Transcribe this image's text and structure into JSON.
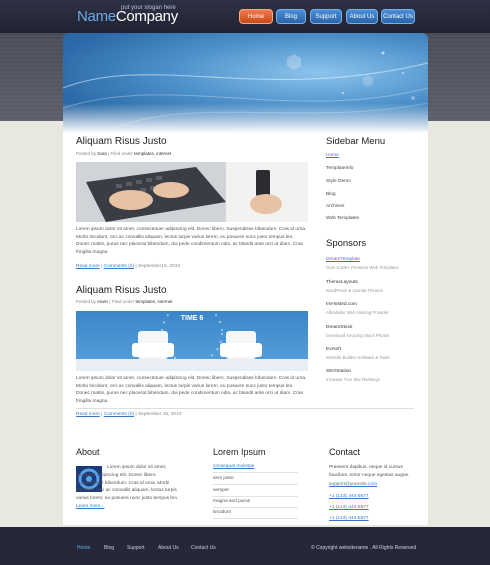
{
  "header": {
    "logo_name": "Name",
    "logo_company": "Company",
    "slogan": "put your slogan here",
    "nav": [
      "Home",
      "Blog",
      "Support",
      "About Us",
      "Contact Us"
    ]
  },
  "posts": [
    {
      "title": "Aliquam Risus Justo",
      "meta_posted": "Posted by",
      "meta_author": "Sara",
      "meta_filed": "| Filed under",
      "meta_tags": "templates, internet",
      "text": "Lorem ipsum dolor sit amet, consectetuer adipiscing elit. Donec libero. Suspendisse bibendum. Cras id urna. Morbi tincidunt, orci ac convallis aliquam, lectus turpis varius lorem, eu posuere nunc justo tempus leo. Donec mattis, purus nec placerat bibendum, dui pede condimentum odio, ac blandit ante orci ut diam. Cras fringilla magna.",
      "read_more": "Read more",
      "comments": "Comments (0)",
      "date": "| September16, 2010"
    },
    {
      "title": "Aliquam Risus Justo",
      "meta_posted": "Posted by",
      "meta_author": "erwin",
      "meta_filed": "| Filed under",
      "meta_tags": "templates, internet",
      "text": "Lorem ipsum dolor sit amet, consectetuer adipiscing elit. Donec libero. Suspendisse bibendum. Cras id urna. Morbi tincidunt, orci ac convallis aliquam, lectus turpis varius lorem, eu posuere nunc justo tempus leo. Donec mattis, purus nec placerat bibendum, dui pede condimentum odio, ac blandit ante orci ut diam. Cras fringilla magna.",
      "read_more": "Read more",
      "comments": "Comments (0)",
      "date": "| September 15, 2010",
      "image_text": "TIME 6"
    }
  ],
  "sidebar": {
    "menu_title": "Sidebar Menu",
    "menu": [
      "Home",
      "TemplateInfo",
      "Style Demo",
      "Blog",
      "Archives",
      "Web Templates"
    ],
    "sponsors_title": "Sponsors",
    "sponsors": [
      {
        "name": "DreamTemplate",
        "desc": "Over 6,000+ Premium Web Templates"
      },
      {
        "name": "ThemeLayouts",
        "desc": "WordPress & Joomla Themes"
      },
      {
        "name": "ImHosted.com",
        "desc": "Affordable Web Hosting Provider"
      },
      {
        "name": "DreamStock",
        "desc": "Download Amazing Stock Photos"
      },
      {
        "name": "Evrsoft",
        "desc": "Website Builder Software & Tools"
      },
      {
        "name": "SEOStation",
        "desc": "Increase Your Site Rankings"
      }
    ]
  },
  "bottom": {
    "about_title": "About",
    "about_text": "Lorem ipsum dolor sit amet, sectetuer adipiscing elit. Donec libero. Suspendisse bibendum. Cras id urna. Morbi tincidunt, orci ac convallis aliquam, lectus turpis varius lorem, eu posuere nunc justo tempus leo.",
    "about_link": "Learn more...",
    "lorem_title": "Lorem Ipsum",
    "lorem_items": [
      "consequat molestie",
      "sem justo",
      "semper",
      "magna sed purus",
      "tincidunt"
    ],
    "contact_title": "Contact",
    "contact_text": "Praesent dapibus, neque id cursus faucibus, tortor neque egestas augue.",
    "contact_email": "support@yoursite.com",
    "contact_phones": [
      "+1 (123) 444-5677",
      "+1 (123) 444-5677",
      "+1 (123) 444-5677"
    ]
  },
  "footer": {
    "nav": [
      "Home",
      "Blog",
      "Support",
      "About Us",
      "Contact Us"
    ],
    "copyright": "© Copyright websitename . All Rights Reserved"
  }
}
